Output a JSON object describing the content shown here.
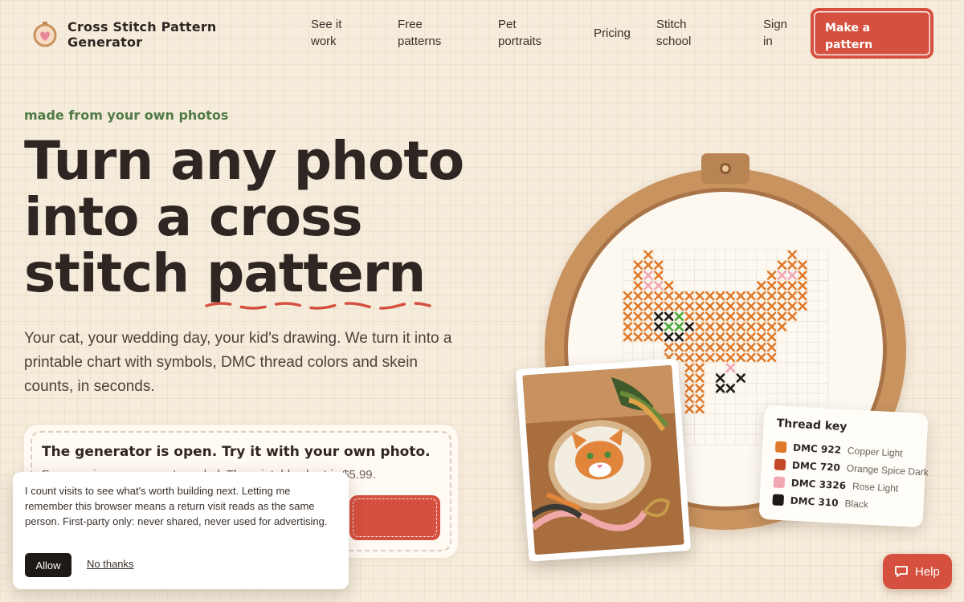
{
  "brand": {
    "name": "Cross Stitch Pattern Generator",
    "logo_icon": "heart-hoop-icon"
  },
  "nav": {
    "items": [
      {
        "label": "See it work"
      },
      {
        "label": "Free patterns"
      },
      {
        "label": "Pet portraits"
      },
      {
        "label": "Pricing"
      },
      {
        "label": "Stitch school"
      },
      {
        "label": "Sign in"
      }
    ],
    "cta_label": "Make a pattern"
  },
  "hero": {
    "eyebrow": "made from your own photos",
    "headline_1": "Turn any photo",
    "headline_2": "into a cross",
    "headline_3a": "stitch ",
    "headline_3b": "pattern",
    "lead": "Your cat, your wedding day, your kid's drawing. We turn it into a printable chart with symbols, DMC thread colors and skein counts, in seconds."
  },
  "card": {
    "title": "The generator is open. Try it with your own photo.",
    "sub_partial": "Free preview, no account needed. The printable chart is $5.99."
  },
  "thread_key": {
    "title": "Thread key",
    "items": [
      {
        "code": "DMC 922",
        "name": "Copper Light",
        "color": "#e07a2a"
      },
      {
        "code": "DMC 720",
        "name": "Orange Spice Dark",
        "color": "#c4492a"
      },
      {
        "code": "DMC 3326",
        "name": "Rose Light",
        "color": "#f2a6b4"
      },
      {
        "code": "DMC 310",
        "name": "Black",
        "color": "#1f1a17"
      }
    ]
  },
  "consent": {
    "text": "I count visits to see what's worth building next. Letting me remember this browser means a return visit reads as the same person. First-party only: never shared, never used for advertising.",
    "allow": "Allow",
    "decline": "No thanks"
  },
  "help": {
    "label": "Help",
    "icon": "chat-bubble-icon"
  },
  "colors": {
    "accent": "#d5503e",
    "green": "#4f7a45",
    "ink": "#2e2622",
    "paper": "#f6ecdc"
  }
}
